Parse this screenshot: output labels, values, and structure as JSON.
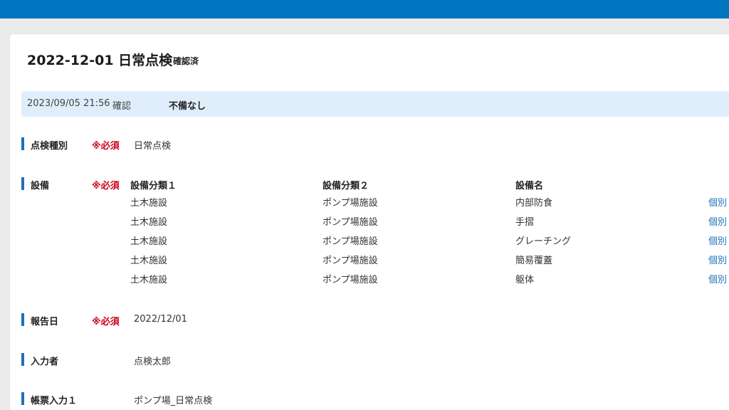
{
  "header": {
    "title": "2022-12-01 日常点検",
    "status": "確認済"
  },
  "notice": {
    "timestamp": "2023/09/05 21:56",
    "label": "確認",
    "result": "不備なし"
  },
  "fields": {
    "inspection_type": {
      "label": "点検種別",
      "required": "※必須",
      "value": "日常点検"
    },
    "equipment": {
      "label": "設備",
      "required": "※必須",
      "columns": [
        "設備分類１",
        "設備分類２",
        "設備名"
      ],
      "rows": [
        {
          "cat1": "土木施設",
          "cat2": "ポンプ場施設",
          "name": "内部防食",
          "link": "個別"
        },
        {
          "cat1": "土木施設",
          "cat2": "ポンプ場施設",
          "name": "手摺",
          "link": "個別"
        },
        {
          "cat1": "土木施設",
          "cat2": "ポンプ場施設",
          "name": "グレーチング",
          "link": "個別"
        },
        {
          "cat1": "土木施設",
          "cat2": "ポンプ場施設",
          "name": "簡易覆蓋",
          "link": "個別"
        },
        {
          "cat1": "土木施設",
          "cat2": "ポンプ場施設",
          "name": "躯体",
          "link": "個別"
        }
      ]
    },
    "report_date": {
      "label": "報告日",
      "required": "※必須",
      "value": "2022/12/01"
    },
    "entered_by": {
      "label": "入力者",
      "value": "点検太郎"
    },
    "form_input": {
      "label": "帳票入力１",
      "value": "ポンプ場_日常点検"
    }
  },
  "colors": {
    "topbar": "#0275c0",
    "accent_bar": "#1c72b8",
    "required": "#d0021b",
    "notice_bg": "#dfeefa",
    "link": "#1c72b8"
  }
}
